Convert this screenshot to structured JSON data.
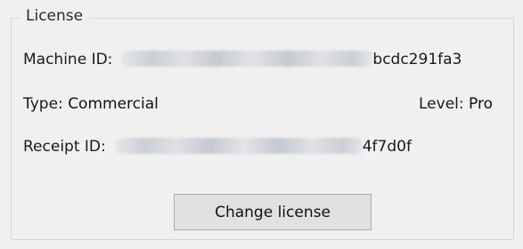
{
  "license": {
    "group_title": "License",
    "machine_id": {
      "label": "Machine ID:",
      "visible_suffix": "bcdc291fa3"
    },
    "type": {
      "label": "Type:",
      "value": "Commercial"
    },
    "level": {
      "label": "Level:",
      "value": "Pro"
    },
    "receipt_id": {
      "label": "Receipt ID:",
      "visible_suffix": "4f7d0f"
    },
    "change_button_label": "Change license"
  }
}
